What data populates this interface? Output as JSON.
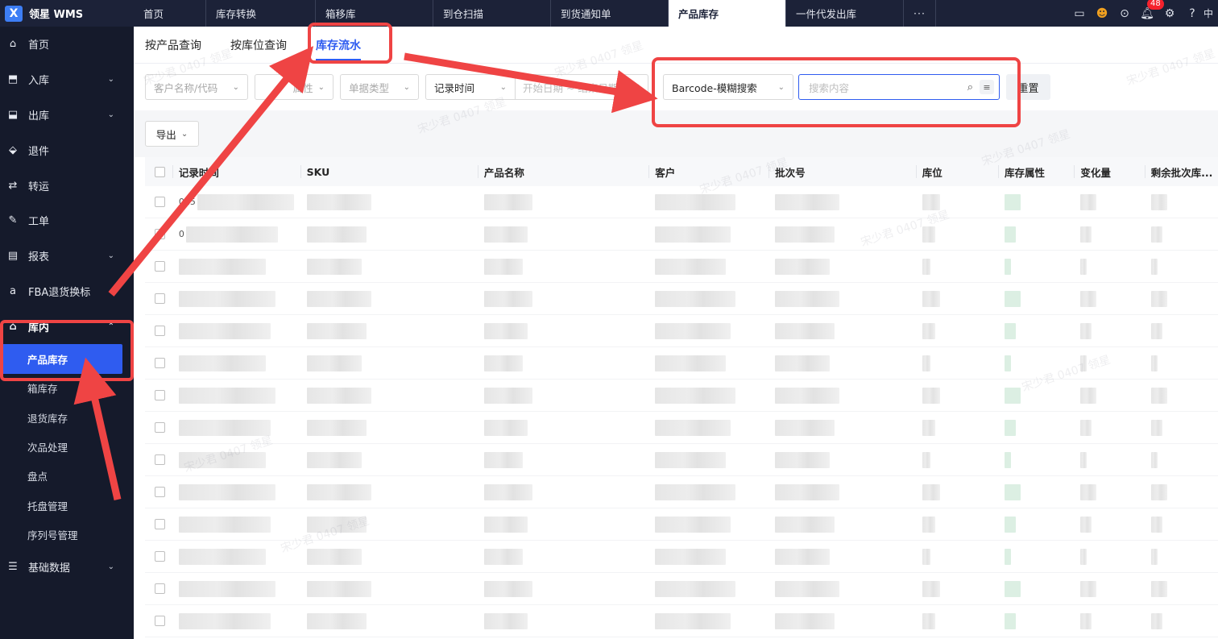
{
  "app": {
    "title": "领星 WMS",
    "logo_letter": "X"
  },
  "top_tabs": [
    {
      "label": "首页",
      "width": 90
    },
    {
      "label": "库存转换",
      "width": 136
    },
    {
      "label": "箱移库",
      "width": 146
    },
    {
      "label": "到仓扫描",
      "width": 146
    },
    {
      "label": "到货通知单",
      "width": 146
    },
    {
      "label": "产品库存",
      "width": 146,
      "active": true
    },
    {
      "label": "一件代发出库",
      "width": 146
    }
  ],
  "top_more": "···",
  "notifications_count": "48",
  "language": "中",
  "sidebar": {
    "items": [
      {
        "label": "首页",
        "icon": "home-icon",
        "glyph": "⌂"
      },
      {
        "label": "入库",
        "icon": "inbound-icon",
        "glyph": "⬒",
        "chevron": "⌄"
      },
      {
        "label": "出库",
        "icon": "outbound-icon",
        "glyph": "⬓",
        "chevron": "⌄"
      },
      {
        "label": "退件",
        "icon": "return-icon",
        "glyph": "⬙"
      },
      {
        "label": "转运",
        "icon": "transfer-icon",
        "glyph": "⇄"
      },
      {
        "label": "工单",
        "icon": "workorder-icon",
        "glyph": "✎"
      },
      {
        "label": "报表",
        "icon": "report-icon",
        "glyph": "▤",
        "chevron": "⌄"
      },
      {
        "label": "FBA退货换标",
        "icon": "amazon-icon",
        "glyph": "a",
        "chevron": "⌄"
      },
      {
        "label": "库内",
        "icon": "warehouse-icon",
        "glyph": "⌂",
        "chevron": "⌃",
        "open": true
      }
    ],
    "sub_items": [
      {
        "label": "产品库存",
        "active": true
      },
      {
        "label": "箱库存"
      },
      {
        "label": "退货库存"
      },
      {
        "label": "次品处理"
      },
      {
        "label": "盘点"
      },
      {
        "label": "托盘管理"
      },
      {
        "label": "序列号管理"
      }
    ],
    "bottom_item": {
      "label": "基础数据",
      "icon": "database-icon",
      "glyph": "☰",
      "chevron": "⌄"
    }
  },
  "sub_tabs": [
    {
      "label": "按产品查询"
    },
    {
      "label": "按库位查询"
    },
    {
      "label": "库存流水",
      "active": true
    }
  ],
  "filters": {
    "customer_placeholder": "客户名称/代码",
    "attribute_placeholder": "属性",
    "doc_type_placeholder": "单据类型",
    "time_field": "记录时间",
    "date_range_placeholder": "开始日期 ~ 结束日期",
    "search_type": "Barcode-模糊搜索",
    "search_placeholder": "搜索内容",
    "reset_label": "重置"
  },
  "toolbar": {
    "export_label": "导出"
  },
  "table": {
    "columns": [
      "记录时间",
      "SKU",
      "产品名称",
      "客户",
      "批次号",
      "库位",
      "库存属性",
      "变化量",
      "剩余批次库..."
    ],
    "rows": [
      {
        "time": "025"
      },
      {
        "time": "0"
      },
      {
        "time": ""
      },
      {
        "time": ""
      },
      {
        "time": ""
      },
      {
        "time": ""
      },
      {
        "time": ""
      },
      {
        "time": ""
      },
      {
        "time": ""
      },
      {
        "time": ""
      },
      {
        "time": ""
      },
      {
        "time": ""
      },
      {
        "time": ""
      },
      {
        "time": ""
      }
    ]
  },
  "watermark_text": "宋少君 0407 领星"
}
